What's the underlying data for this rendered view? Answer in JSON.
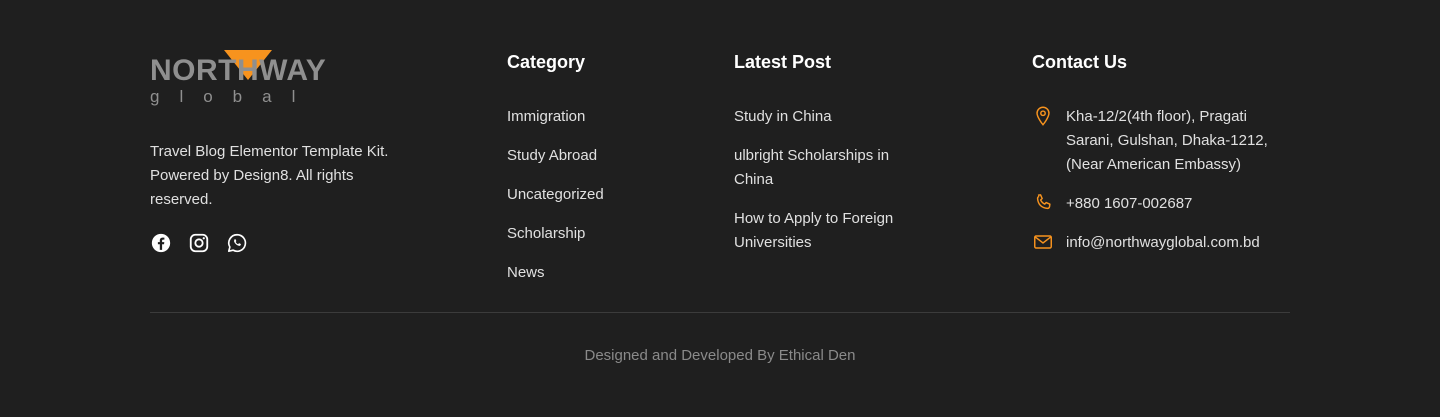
{
  "brand": {
    "logo_word": "NORTHWAY",
    "logo_sub": "global",
    "description": "Travel Blog Elementor Template Kit. Powered by Design8. All rights reserved.",
    "social_icons": [
      "facebook-icon",
      "instagram-icon",
      "whatsapp-icon"
    ]
  },
  "category": {
    "title": "Category",
    "items": [
      {
        "label": "Immigration"
      },
      {
        "label": "Study Abroad"
      },
      {
        "label": "Uncategorized"
      },
      {
        "label": "Scholarship"
      },
      {
        "label": "News"
      }
    ]
  },
  "latest_post": {
    "title": "Latest Post",
    "items": [
      {
        "label": "Study in China"
      },
      {
        "label": "ulbright Scholarships in China"
      },
      {
        "label": "How to Apply to Foreign Universities"
      }
    ]
  },
  "contact": {
    "title": "Contact Us",
    "address": "Kha-12/2(4th floor), Pragati Sarani, Gulshan, Dhaka-1212, (Near American Embassy)",
    "phone": "+880 1607-002687",
    "email": "info@northwayglobal.com.bd"
  },
  "footer": {
    "credit": "Designed and Developed By Ethical Den"
  },
  "colors": {
    "background": "#1f1f1f",
    "accent": "#f7931e",
    "logo_gray": "#8f8f8f"
  }
}
